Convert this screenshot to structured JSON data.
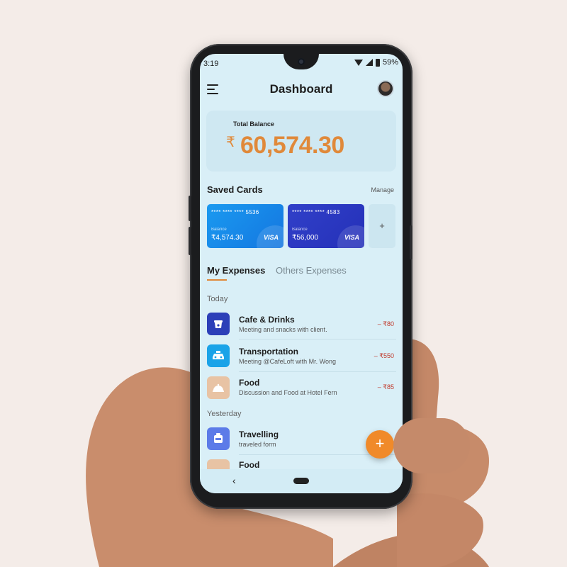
{
  "status_bar": {
    "time": "3:19",
    "battery": "59%"
  },
  "header": {
    "title": "Dashboard"
  },
  "balance": {
    "label": "Total Balance",
    "currency_symbol": "₹",
    "amount": "60,574.30"
  },
  "saved_cards": {
    "title": "Saved Cards",
    "manage_label": "Manage",
    "add_label": "+",
    "cards": [
      {
        "number": "**** **** **** 5536",
        "balance_label": "Balance",
        "balance": "₹4,574.30",
        "brand": "VISA",
        "color": "#1a8cf0"
      },
      {
        "number": "**** **** **** 4583",
        "balance_label": "Balance",
        "balance": "₹56,000",
        "brand": "VISA",
        "color": "#2b36c2"
      }
    ]
  },
  "tabs": {
    "active": "My Expenses",
    "inactive": "Others Expenses"
  },
  "expenses": {
    "today_label": "Today",
    "yesterday_label": "Yesterday",
    "items": [
      {
        "title": "Cafe & Drinks",
        "subtitle": "Meeting and snacks with client.",
        "amount": "– ₹80",
        "icon": "cafe-icon",
        "icon_color": "#2c3fb8"
      },
      {
        "title": "Transportation",
        "subtitle": "Meeting @CafeLoft with Mr. Wong",
        "amount": "– ₹550",
        "icon": "taxi-icon",
        "icon_color": "#1aa3e8"
      },
      {
        "title": "Food",
        "subtitle": "Discussion and Food at Hotel Fern",
        "amount": "– ₹85",
        "icon": "food-icon",
        "icon_color": "#e8c3a4"
      },
      {
        "title": "Travelling",
        "subtitle": "traveled form",
        "amount": "",
        "icon": "travel-icon",
        "icon_color": "#5c7be8"
      },
      {
        "title": "Food",
        "subtitle": "",
        "amount": "",
        "icon": "food-icon",
        "icon_color": "#e8c3a4"
      }
    ]
  },
  "fab_label": "+",
  "nav": {
    "back_glyph": "‹"
  },
  "colors": {
    "accent": "#e0893a",
    "screen_bg": "#d9eff7",
    "negative": "#c0392b"
  }
}
